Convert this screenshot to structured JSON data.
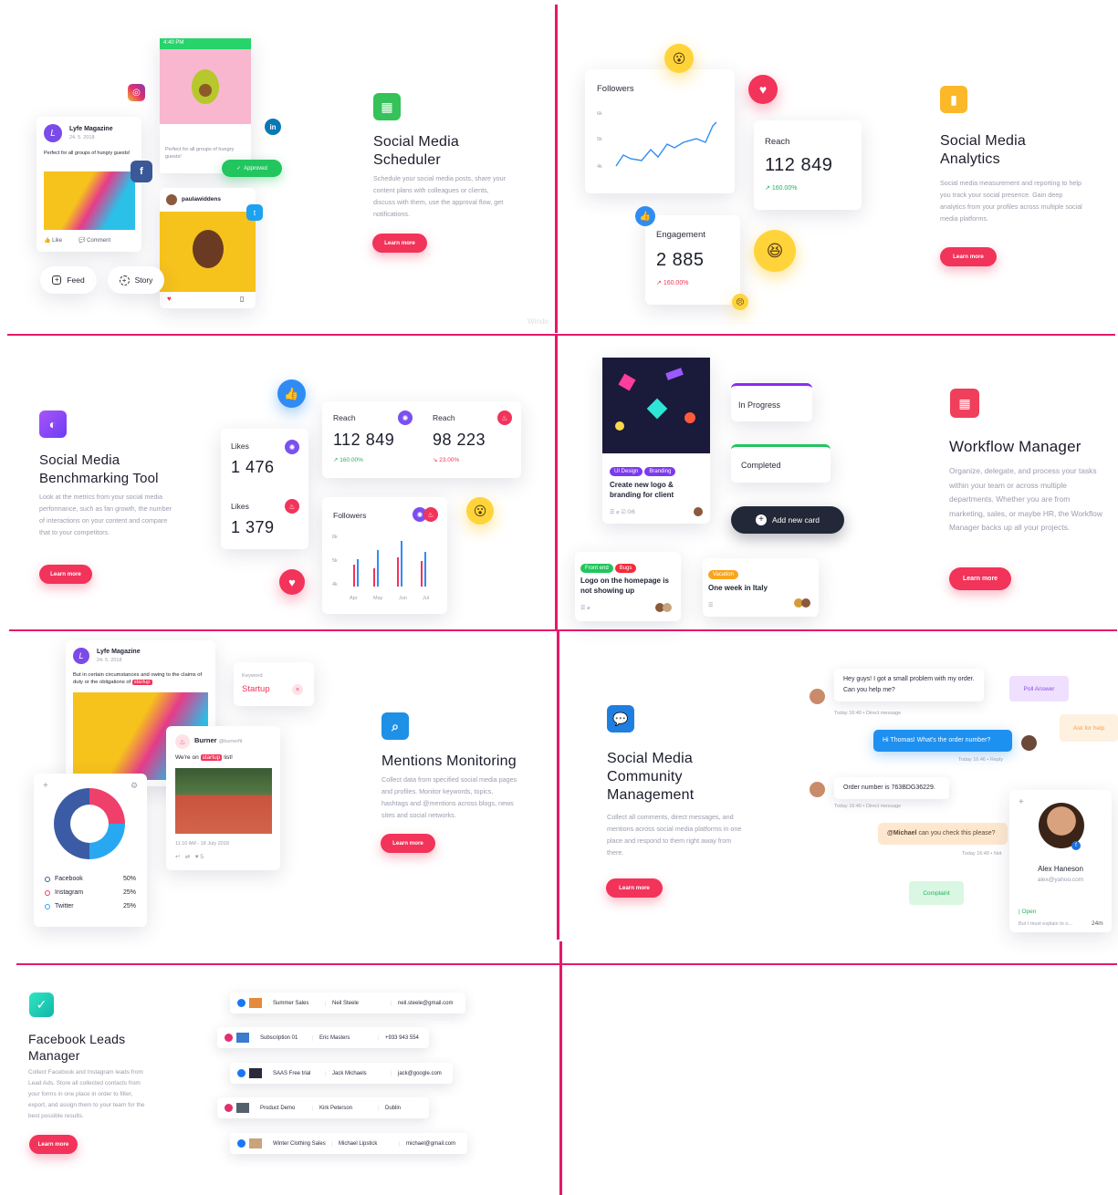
{
  "scheduler": {
    "icon": "calendar-icon",
    "title_line1": "Social Media",
    "title_line2": "Scheduler",
    "desc": "Schedule your social media posts, share your content plans with colleagues or clients, discuss with them, use the approval flow, get notifications.",
    "button": "Learn more",
    "post_brand": "Lyfe Magazine",
    "post_date": "24. 5. 2018",
    "post_text": "Perfect for all groups of hungry guests!",
    "like": "Like",
    "comment": "Comment",
    "phone_time": "4:40 PM",
    "phone_caption": "Perfect for all groups of hungry guests!",
    "approved": "Approved",
    "user": "paulawiddens",
    "feed": "Feed",
    "story": "Story",
    "watermark": "Windo"
  },
  "analytics": {
    "icon": "bar-chart-icon",
    "title_line1": "Social Media",
    "title_line2": "Analytics",
    "desc": "Social media measurement and reporting to help you track your social presence. Gain deep analytics from your profiles across multiple social media platforms.",
    "button": "Learn more",
    "followers_label": "Followers",
    "y_ticks": [
      "6k",
      "5k",
      "4k"
    ],
    "reach_label": "Reach",
    "reach_value": "112 849",
    "reach_change": "160.00%",
    "engagement_label": "Engagement",
    "engagement_value": "2 885",
    "engagement_change": "160.00%"
  },
  "benchmark": {
    "icon": "toggle-icon",
    "title_line1": "Social Media",
    "title_line2": "Benchmarking Tool",
    "desc": "Look at the metrics from your social media performance, such as fan growth, the number of interactions on your content and compare that to your competitors.",
    "button": "Learn more",
    "likes1_label": "Likes",
    "likes1_value": "1 476",
    "likes2_label": "Likes",
    "likes2_value": "1 379",
    "reach1_label": "Reach",
    "reach1_value": "112 849",
    "reach1_change": "160.00%",
    "reach2_label": "Reach",
    "reach2_value": "98 223",
    "reach2_change": "23.00%",
    "followers_label": "Followers",
    "y_ticks": [
      "6k",
      "5k",
      "4k"
    ],
    "months": [
      "Apr",
      "May",
      "Jun",
      "Jul"
    ]
  },
  "workflow": {
    "icon": "grid-icon",
    "title": "Workflow Manager",
    "desc": "Organize, delegate, and process your tasks within your team or across multiple departments. Whether you are from marketing, sales, or maybe HR, the Workflow Manager backs up all your projects.",
    "button": "Learn more",
    "tag_ui": "UI Design",
    "tag_branding": "Branding",
    "task1": "Create new logo & branding for client",
    "task1_meta": "0/6",
    "col_in_progress": "In Progress",
    "col_completed": "Completed",
    "add_card": "Add new card",
    "tag_frontend": "Front end",
    "tag_bugs": "Bugs",
    "task2": "Logo on the homepage is not showing up",
    "tag_vacation": "Vacation",
    "task3": "One week in Italy"
  },
  "mentions": {
    "icon": "search-icon",
    "title": "Mentions Monitoring",
    "desc": "Collect data from specified social media pages and profiles. Monitor keywords, topics, hashtags and @mentions across blogs, news sites and social networks.",
    "button": "Learn more",
    "post_brand": "Lyfe Magazine",
    "post_date": "24. 5. 2018",
    "post_text": "But in certain circumstances and owing to the claims of duty or the obligations of",
    "post_tag": "startup",
    "keyword_label": "Keyword",
    "keyword_value": "Startup",
    "burner_name": "Burner",
    "burner_handle": "@burnerfit",
    "burner_text_a": "We're on",
    "burner_tag": "startup",
    "burner_text_b": "list!",
    "burner_time": "11:10 AM - 18 July 2018",
    "burner_likes": "5",
    "legend": [
      {
        "name": "Facebook",
        "value": "50%",
        "color": "#3b5ba5"
      },
      {
        "name": "Instagram",
        "value": "25%",
        "color": "#ef3f6b"
      },
      {
        "name": "Twitter",
        "value": "25%",
        "color": "#29a8f2"
      }
    ]
  },
  "community": {
    "icon": "chat-icon",
    "title_line1": "Social Media",
    "title_line2": "Community",
    "title_line3": "Management",
    "desc": "Collect all comments, direct messages, and mentions across social media platforms in one place and respond to them right away from there.",
    "button": "Learn more",
    "msg1": "Hey guys! I got a small problem with my order. Can you help me?",
    "msg1_meta": "Today 16:40 • Direct message",
    "msg2": "Hi Thomas! What's the order number?",
    "msg2_meta": "Today 16:46 • Reply",
    "msg3": "Order number is 763BDG36229.",
    "msg3_meta": "Today 16:40 • Direct message",
    "msg4_mention": "@Michael",
    "msg4_rest": " can you check this please?",
    "msg4_meta": "Today 16:40 • Not",
    "tag_poll": "Poll Answer",
    "tag_help": "Ask for help",
    "tag_complaint": "Complaint",
    "contact_name": "Alex Haneson",
    "contact_email": "alex@yahoo.com",
    "status": "Open",
    "status_text": "But I must explain to o...",
    "status_time": "24m"
  },
  "leads": {
    "icon": "check-icon",
    "title_line1": "Facebook Leads",
    "title_line2": "Manager",
    "desc": "Collect Facebook and Instagram leads from Lead Ads. Store all collected contacts from your forms in one place in order to filter, export, and assign them to your team for the best possible results.",
    "button": "Learn more",
    "rows": [
      {
        "source": "facebook",
        "campaign": "Summer Sales",
        "name": "Neil Steele",
        "contact": "neil.steele@gmail.com"
      },
      {
        "source": "instagram",
        "campaign": "Subscription 01",
        "name": "Eric Masters",
        "contact": "+933 943 554"
      },
      {
        "source": "facebook",
        "campaign": "SAAS Free trial",
        "name": "Jack Michaels",
        "contact": "jack@google.com"
      },
      {
        "source": "instagram",
        "campaign": "Product Demo",
        "name": "Kirk Peterson",
        "contact": "Dublin"
      },
      {
        "source": "facebook",
        "campaign": "Winter Clothing Sales",
        "name": "Michael Lipstick",
        "contact": "michael@gmail.com"
      }
    ]
  },
  "colors": {
    "accent": "#f2335a",
    "divider": "#e6186a",
    "positive": "#22b45a",
    "chart_line": "#2f8cf5"
  }
}
